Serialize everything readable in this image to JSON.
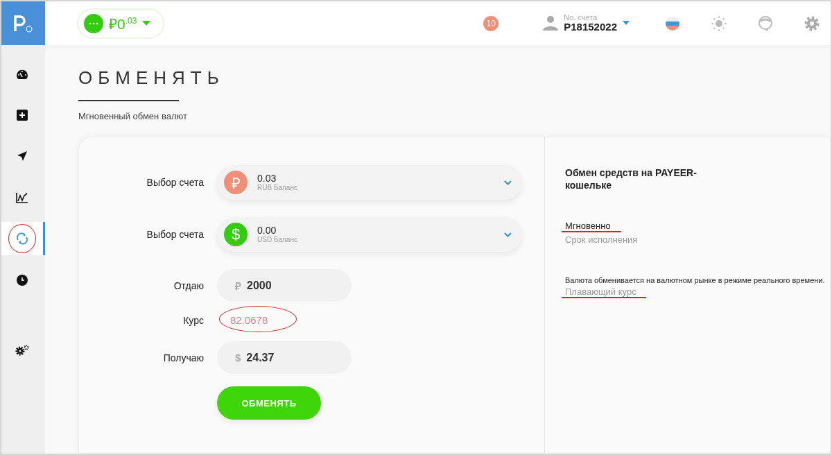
{
  "header": {
    "balance": {
      "symbol": "₽",
      "whole": "0",
      "fraction": ".03"
    },
    "notifications": "10",
    "account": {
      "label": "No. счета",
      "number": "P18152022"
    }
  },
  "sidebar": {
    "items": [
      {
        "kind": "dashboard",
        "selected": false,
        "annotated": false
      },
      {
        "kind": "add",
        "selected": false,
        "annotated": false
      },
      {
        "kind": "send",
        "selected": false,
        "annotated": false
      },
      {
        "kind": "chart",
        "selected": false,
        "annotated": false
      },
      {
        "kind": "exchange",
        "selected": true,
        "annotated": true
      },
      {
        "kind": "history",
        "selected": false,
        "annotated": false
      },
      {
        "kind": "settings",
        "selected": false,
        "annotated": false
      }
    ]
  },
  "page": {
    "title": "ОБМЕНЯТЬ",
    "subtitle": "Мгновенный обмен валют"
  },
  "form": {
    "accounts": [
      {
        "label": "Выбор счета",
        "kind": "rub",
        "symbol": "₽",
        "amount": "0.03",
        "caption": "RUB Баланс"
      },
      {
        "label": "Выбор счета",
        "kind": "usd",
        "symbol": "$",
        "amount": "0.00",
        "caption": "USD Баланс"
      }
    ],
    "give": {
      "label": "Отдаю",
      "symbol": "₽",
      "value": "2000"
    },
    "rate": {
      "label": "Курс",
      "value": "82.0678",
      "annotated": true
    },
    "receive": {
      "label": "Получаю",
      "symbol": "$",
      "value": "24.37"
    },
    "button": "ОБМЕНЯТЬ"
  },
  "info": {
    "title": "Обмен средств на PAYEER-кошельке",
    "speed": {
      "value": "Мгновенно",
      "label": "Срок исполнения",
      "annotated": true
    },
    "description": "Валюта обменивается на валютном рынке в режиме реального времени.",
    "rate_type": {
      "value": "Плавающий курс",
      "annotated": true
    }
  }
}
